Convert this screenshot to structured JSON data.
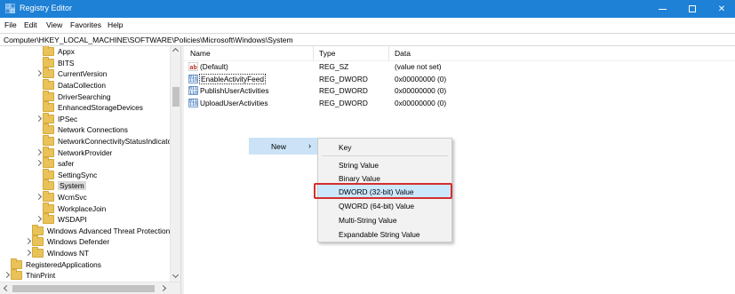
{
  "window": {
    "title": "Registry Editor",
    "controls": {
      "minimize": "—",
      "maximize": "☐",
      "close": "✕"
    }
  },
  "menubar": [
    "File",
    "Edit",
    "View",
    "Favorites",
    "Help"
  ],
  "address": "Computer\\HKEY_LOCAL_MACHINE\\SOFTWARE\\Policies\\Microsoft\\Windows\\System",
  "tree": [
    {
      "label": "Appx",
      "expandable": false,
      "depth": 2
    },
    {
      "label": "BITS",
      "expandable": false,
      "depth": 2
    },
    {
      "label": "CurrentVersion",
      "expandable": true,
      "depth": 2
    },
    {
      "label": "DataCollection",
      "expandable": false,
      "depth": 2
    },
    {
      "label": "DriverSearching",
      "expandable": false,
      "depth": 2
    },
    {
      "label": "EnhancedStorageDevices",
      "expandable": false,
      "depth": 2
    },
    {
      "label": "IPSec",
      "expandable": true,
      "depth": 2
    },
    {
      "label": "Network Connections",
      "expandable": false,
      "depth": 2
    },
    {
      "label": "NetworkConnectivityStatusIndicato",
      "expandable": false,
      "depth": 2
    },
    {
      "label": "NetworkProvider",
      "expandable": true,
      "depth": 2
    },
    {
      "label": "safer",
      "expandable": true,
      "depth": 2
    },
    {
      "label": "SettingSync",
      "expandable": false,
      "depth": 2
    },
    {
      "label": "System",
      "expandable": false,
      "depth": 2,
      "selected": true
    },
    {
      "label": "WcmSvc",
      "expandable": true,
      "depth": 2
    },
    {
      "label": "WorkplaceJoin",
      "expandable": false,
      "depth": 2
    },
    {
      "label": "WSDAPI",
      "expandable": true,
      "depth": 2
    },
    {
      "label": "Windows Advanced Threat Protection",
      "expandable": false,
      "depth": 1
    },
    {
      "label": "Windows Defender",
      "expandable": true,
      "depth": 1
    },
    {
      "label": "Windows NT",
      "expandable": true,
      "depth": 1
    },
    {
      "label": "RegisteredApplications",
      "expandable": false,
      "depth": 0
    },
    {
      "label": "ThinPrint",
      "expandable": true,
      "depth": 0
    }
  ],
  "columns": {
    "name": "Name",
    "type": "Type",
    "data": "Data"
  },
  "values": [
    {
      "name": "(Default)",
      "type": "REG_SZ",
      "data": "(value not set)",
      "icon": "string-value-icon",
      "icon_text": "ab"
    },
    {
      "name": "EnableActivityFeed",
      "type": "REG_DWORD",
      "data": "0x00000000 (0)",
      "icon": "binary-value-icon",
      "icon_text": "011 110"
    },
    {
      "name": "PublishUserActivities",
      "type": "REG_DWORD",
      "data": "0x00000000 (0)",
      "icon": "binary-value-icon",
      "icon_text": "011 110"
    },
    {
      "name": "UploadUserActivities",
      "type": "REG_DWORD",
      "data": "0x00000000 (0)",
      "icon": "binary-value-icon",
      "icon_text": "011 110"
    }
  ],
  "new_menu": {
    "label": "New",
    "arrow": "›"
  },
  "context_menu": [
    "Key",
    "String Value",
    "Binary Value",
    "DWORD (32-bit) Value",
    "QWORD (64-bit) Value",
    "Multi-String Value",
    "Expandable String Value"
  ],
  "colors": {
    "titlebar": "#1e81d6",
    "highlight_box": "#d32f2f",
    "folder": "#e8c35a"
  }
}
